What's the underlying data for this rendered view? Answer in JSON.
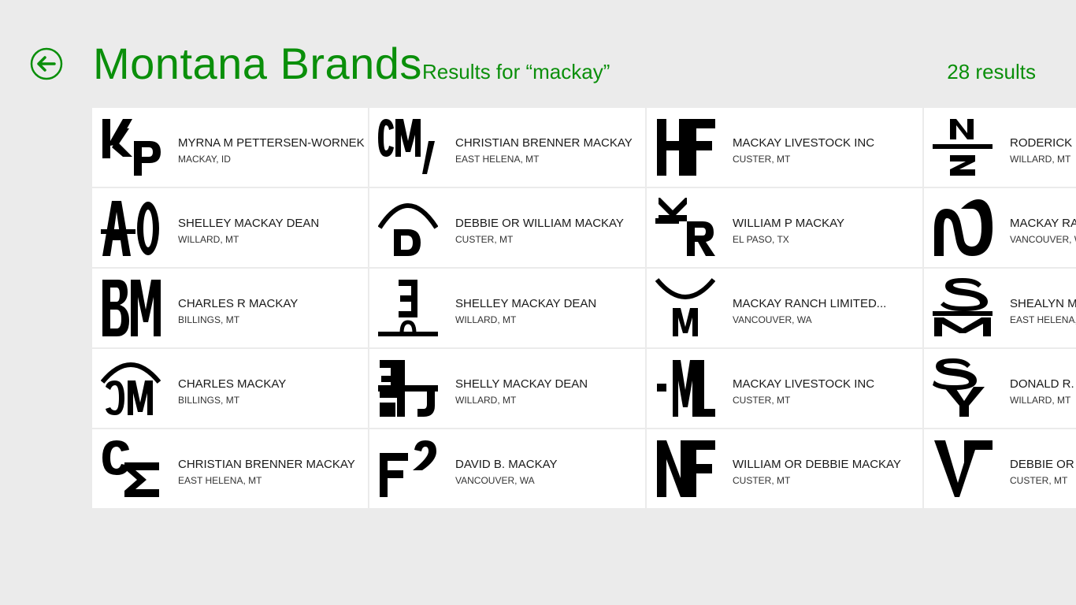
{
  "header": {
    "title": "Montana Brands",
    "results_for": "Results for “mackay”",
    "results_count": "28 results"
  },
  "colors": {
    "accent": "#0a8f0a",
    "background": "#ebebeb",
    "tile": "#ffffff"
  },
  "results": [
    {
      "name": "MYRNA M PETTERSEN-WORNEK",
      "location": "MACKAY, ID",
      "brand_glyph": "KP"
    },
    {
      "name": "SHELLEY MACKAY DEAN",
      "location": "WILLARD, MT",
      "brand_glyph": "A-O"
    },
    {
      "name": "CHARLES R MACKAY",
      "location": "BILLINGS, MT",
      "brand_glyph": "BM"
    },
    {
      "name": "CHARLES MACKAY",
      "location": "BILLINGS, MT",
      "brand_glyph": "arc-CM"
    },
    {
      "name": "CHRISTIAN BRENNER MACKAY",
      "location": "EAST HELENA, MT",
      "brand_glyph": "C-sigma"
    },
    {
      "name": "CHRISTIAN BRENNER MACKAY",
      "location": "EAST HELENA, MT",
      "brand_glyph": "CM/"
    },
    {
      "name": "DEBBIE OR WILLIAM MACKAY",
      "location": "CUSTER, MT",
      "brand_glyph": "arc-D"
    },
    {
      "name": "SHELLEY MACKAY DEAN",
      "location": "WILLARD, MT",
      "brand_glyph": "E-bar"
    },
    {
      "name": "SHELLY MACKAY DEAN",
      "location": "WILLARD, MT",
      "brand_glyph": "E-H-J"
    },
    {
      "name": "DAVID B. MACKAY",
      "location": "VANCOUVER, WA",
      "brand_glyph": "F2"
    },
    {
      "name": "MACKAY LIVESTOCK INC",
      "location": "CUSTER, MT",
      "brand_glyph": "HF"
    },
    {
      "name": "WILLIAM P MACKAY",
      "location": "EL PASO, TX",
      "brand_glyph": "KR"
    },
    {
      "name": "MACKAY RANCH LIMITED...",
      "location": "VANCOUVER, WA",
      "brand_glyph": "arc-M"
    },
    {
      "name": "MACKAY LIVESTOCK INC",
      "location": "CUSTER, MT",
      "brand_glyph": "-ML"
    },
    {
      "name": "WILLIAM OR DEBBIE MACKAY",
      "location": "CUSTER, MT",
      "brand_glyph": "NF"
    },
    {
      "name": "RODERICK M",
      "location": "WILLARD, MT",
      "brand_glyph": "N-bar-Z"
    },
    {
      "name": "MACKAY RAN",
      "location": "VANCOUVER, W",
      "brand_glyph": "2-lazy"
    },
    {
      "name": "SHEALYN MA",
      "location": "EAST HELENA, M",
      "brand_glyph": "S-bar-M"
    },
    {
      "name": "DONALD R. C",
      "location": "WILLARD, MT",
      "brand_glyph": "SY"
    },
    {
      "name": "DEBBIE OR W",
      "location": "CUSTER, MT",
      "brand_glyph": "VT"
    }
  ]
}
